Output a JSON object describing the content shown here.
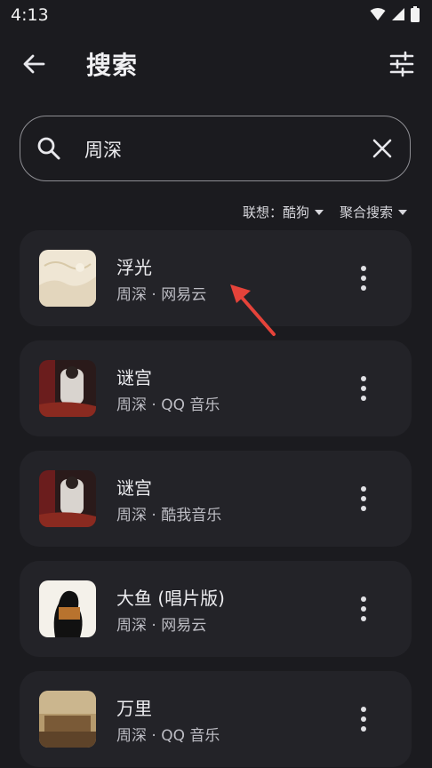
{
  "status_bar": {
    "time": "4:13"
  },
  "app_bar": {
    "title": "搜索"
  },
  "search": {
    "value": "周深"
  },
  "filters": [
    {
      "label": "联想：酷狗"
    },
    {
      "label": "聚合搜索"
    }
  ],
  "results": [
    {
      "title": "浮光",
      "subtitle": "周深 · 网易云"
    },
    {
      "title": "谜宫",
      "subtitle": "周深 · QQ 音乐"
    },
    {
      "title": "谜宫",
      "subtitle": "周深 · 酷我音乐"
    },
    {
      "title": "大鱼 (唱片版)",
      "subtitle": "周深 · 网易云"
    },
    {
      "title": "万里",
      "subtitle": "周深 · QQ 音乐"
    }
  ],
  "colors": {
    "annotation_arrow": "#e5433a",
    "card": "#232328",
    "background": "#1b1b1f"
  }
}
